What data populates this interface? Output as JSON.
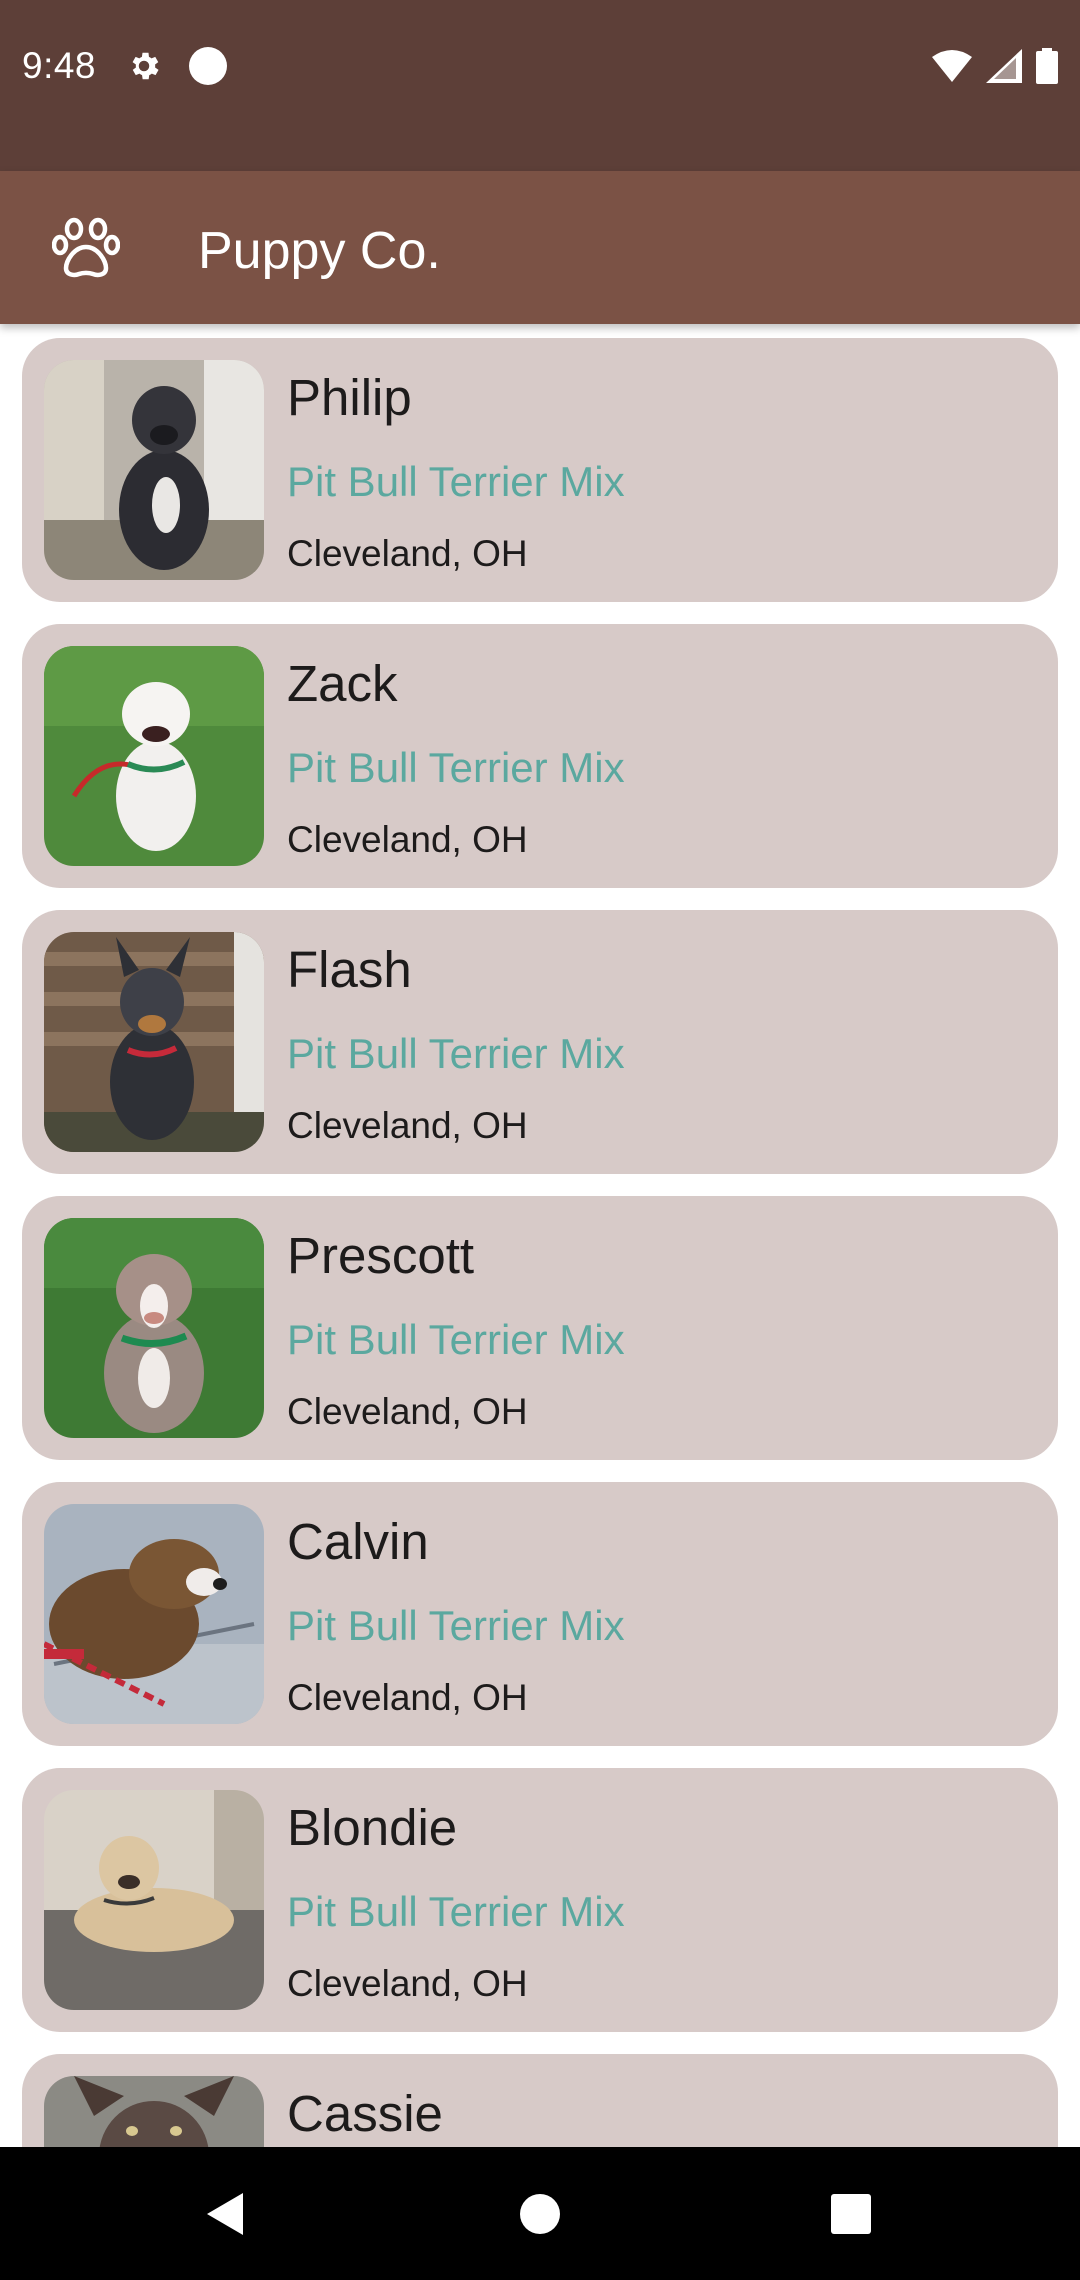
{
  "status_bar": {
    "time": "9:48",
    "icons": [
      "settings-gear-icon",
      "circle-dot-icon",
      "wifi-icon",
      "cell-signal-icon",
      "battery-icon"
    ]
  },
  "app_bar": {
    "logo_icon": "paw-icon",
    "title": "Puppy Co."
  },
  "pets": [
    {
      "name": "Philip",
      "breed": "Pit Bull Terrier Mix",
      "location": "Cleveland, OH"
    },
    {
      "name": "Zack",
      "breed": "Pit Bull Terrier Mix",
      "location": "Cleveland, OH"
    },
    {
      "name": "Flash",
      "breed": "Pit Bull Terrier Mix",
      "location": "Cleveland, OH"
    },
    {
      "name": "Prescott",
      "breed": "Pit Bull Terrier Mix",
      "location": "Cleveland, OH"
    },
    {
      "name": "Calvin",
      "breed": "Pit Bull Terrier Mix",
      "location": "Cleveland, OH"
    },
    {
      "name": "Blondie",
      "breed": "Pit Bull Terrier Mix",
      "location": "Cleveland, OH"
    },
    {
      "name": "Cassie"
    }
  ],
  "nav_bar": {
    "icons": [
      "back-icon",
      "home-icon",
      "recents-icon"
    ]
  },
  "colors": {
    "status_bar": "#5d3f38",
    "app_bar": "#7b5245",
    "card": "#d7cac8",
    "breed_text": "#5ba89f",
    "primary_text": "#1d1b1b"
  }
}
